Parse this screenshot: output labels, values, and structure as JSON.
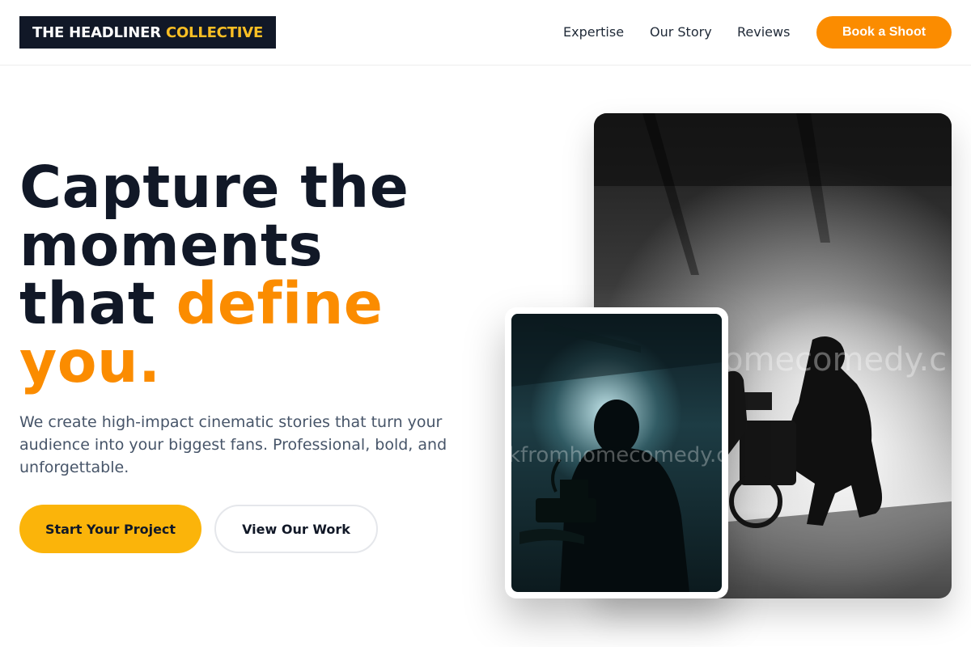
{
  "brand": {
    "part1": "THE HEADLINER",
    "part2": "COLLECTIVE"
  },
  "nav": {
    "items": [
      {
        "label": "Expertise"
      },
      {
        "label": "Our Story"
      },
      {
        "label": "Reviews"
      }
    ],
    "cta": "Book a Shoot"
  },
  "hero": {
    "title_line1": "Capture the",
    "title_line2": "moments",
    "title_line3a": "that ",
    "title_line3b": "define",
    "title_line4": "you.",
    "subtitle": "We create high-impact cinematic stories that turn your audience into your biggest fans. Professional, bold, and unforgettable.",
    "primary_button": "Start Your Project",
    "secondary_button": "View Our Work"
  },
  "images": {
    "large_watermark": "omecomedy.c",
    "small_watermark": "kfromhomecomedy.c"
  },
  "colors": {
    "accent_orange": "#fb8c00",
    "accent_yellow": "#fbb40a",
    "dark": "#111827"
  }
}
